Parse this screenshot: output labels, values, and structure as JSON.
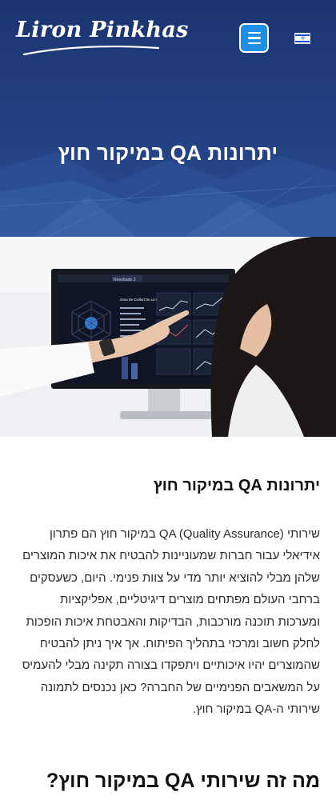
{
  "header": {
    "logo_text": "Liron Pinkhas",
    "menu_icon": "hamburger-icon",
    "language_flag": "israel-flag-icon"
  },
  "hero": {
    "title": "יתרונות QA במיקור חוץ"
  },
  "photo": {
    "screen_tab_label": "Resultado 2",
    "screen_heading": "Zona De Confort De La Plataforma"
  },
  "article": {
    "heading": "יתרונות QA במיקור חוץ",
    "paragraph": "שירותי QA (Quality Assurance) במיקור חוץ הם פתרון אידיאלי עבור חברות שמעוניינות להבטיח את איכות המוצרים שלהן מבלי להוציא יותר מדי על צוות פנימי. היום, כשעסקים ברחבי העולם מפתחים מוצרים דיגיטליים, אפליקציות ומערכות תוכנה מורכבות, הבדיקות והאבטחת איכות הופכות לחלק חשוב ומרכזי בתהליך הפיתוח. אך איך ניתן להבטיח שהמוצרים יהיו איכותיים ויתפקדו בצורה תקינה מבלי להעמיס על המשאבים הפנימיים של החברה? כאן נכנסים לתמונה שירותי ה-QA במיקור חוץ.",
    "heading_2": "מה זה שירותי QA במיקור חוץ?"
  },
  "colors": {
    "hero_bg": "#1b3470",
    "menu_button": "#1f8fe5",
    "text": "#111111"
  }
}
